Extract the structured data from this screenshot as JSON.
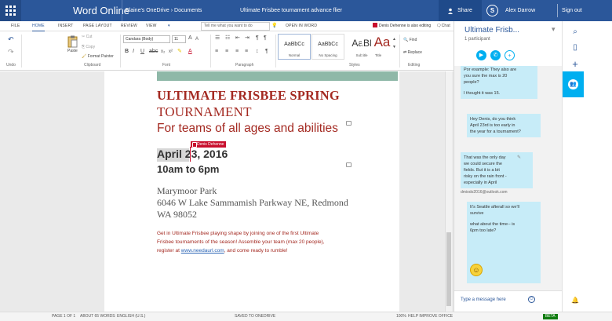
{
  "titlebar": {
    "brand": "Word Online",
    "breadcrumb": "Elaine's OneDrive › Documents",
    "doc_title": "Ultimate Frisbee tournament advance flier",
    "share_label": "Share",
    "user": "Alex Darrow",
    "sign_out": "Sign out",
    "accent": "#2b579a"
  },
  "tabs": [
    {
      "label": "FILE"
    },
    {
      "label": "HOME"
    },
    {
      "label": "INSERT"
    },
    {
      "label": "PAGE LAYOUT"
    },
    {
      "label": "REVIEW"
    },
    {
      "label": "VIEW"
    }
  ],
  "tellme_placeholder": "Tell me what you want to do",
  "open_in_word": "OPEN IN WORD",
  "editing_notice": "Denis Dehenne is also editing",
  "chat_tab": "Chat",
  "ribbon": {
    "undo": "Undo",
    "paste": "Paste",
    "cut": "Cut",
    "copy": "Copy",
    "format_painter": "Format Painter",
    "clipboard": "Clipboard",
    "font_name": "Candara (Body)",
    "font_size": "11",
    "font": "Font",
    "paragraph": "Paragraph",
    "styles_label": "Styles",
    "styles": [
      {
        "sample": "AaBbCc",
        "name": "Normal"
      },
      {
        "sample": "AaBbCc",
        "name": "No Spacing"
      },
      {
        "sample": "AaBl",
        "name": "Subtitle"
      },
      {
        "sample": "Aa",
        "name": "Title"
      }
    ],
    "find": "Find",
    "replace": "Replace",
    "editing": "Editing"
  },
  "document": {
    "title_line1": "ULTIMATE FRISBEE SPRING",
    "title_line2": "TOURNAMENT",
    "subtitle": "For teams of all ages and abilities",
    "date": "April 23, 2016",
    "coauthor_tag": "Denis Dehenne",
    "time": "10am to 6pm",
    "address1": "Marymoor Park",
    "address2": "6046 W Lake Sammamish Parkway NE, Redmond",
    "address3": "WA 98052",
    "body1": "Get in Ultimate Frisbee playing shape by joining one of the first Ultimate",
    "body2": "Frisbee tournaments of the season!   Assemble your team (max 20 people),",
    "body3_pre": "register at ",
    "body3_link": "www.needaurl.com",
    "body3_post": ", and come ready to rumble!",
    "title_color": "#a42a22",
    "banner_color": "#8fb8a8"
  },
  "status": {
    "page": "PAGE 1 OF 1",
    "words": "ABOUT 65 WORDS",
    "language": "ENGLISH (U.S.)",
    "saved": "SAVED TO ONEDRIVE",
    "zoom": "100%",
    "help": "HELP IMPROVE OFFICE",
    "beta": "BETA"
  },
  "chat": {
    "title": "Ultimate Frisb...",
    "participants": "1 participant",
    "messages": [
      {
        "lines": [
          "Por example: They also are",
          "you sure the max is 20",
          "people?",
          "",
          "I thought it was 15."
        ]
      },
      {
        "lines": [
          "Hey Denis, do you think",
          "April 23rd is too early in",
          "the year for a tournament?"
        ]
      },
      {
        "lines": [
          "That was the only day",
          "we could secure the",
          "fields.  But it is a bit",
          "risky on the rain front -",
          "especially in April"
        ]
      },
      {
        "lines": [
          "It's Seattle afterall so we'll",
          "survive",
          "",
          "what about the time-- is",
          "6pm too late?"
        ]
      }
    ],
    "sender": "dmiodo2016@outlook.com",
    "input_placeholder": "Type a message here",
    "bubble_color": "#c7ecf8"
  }
}
